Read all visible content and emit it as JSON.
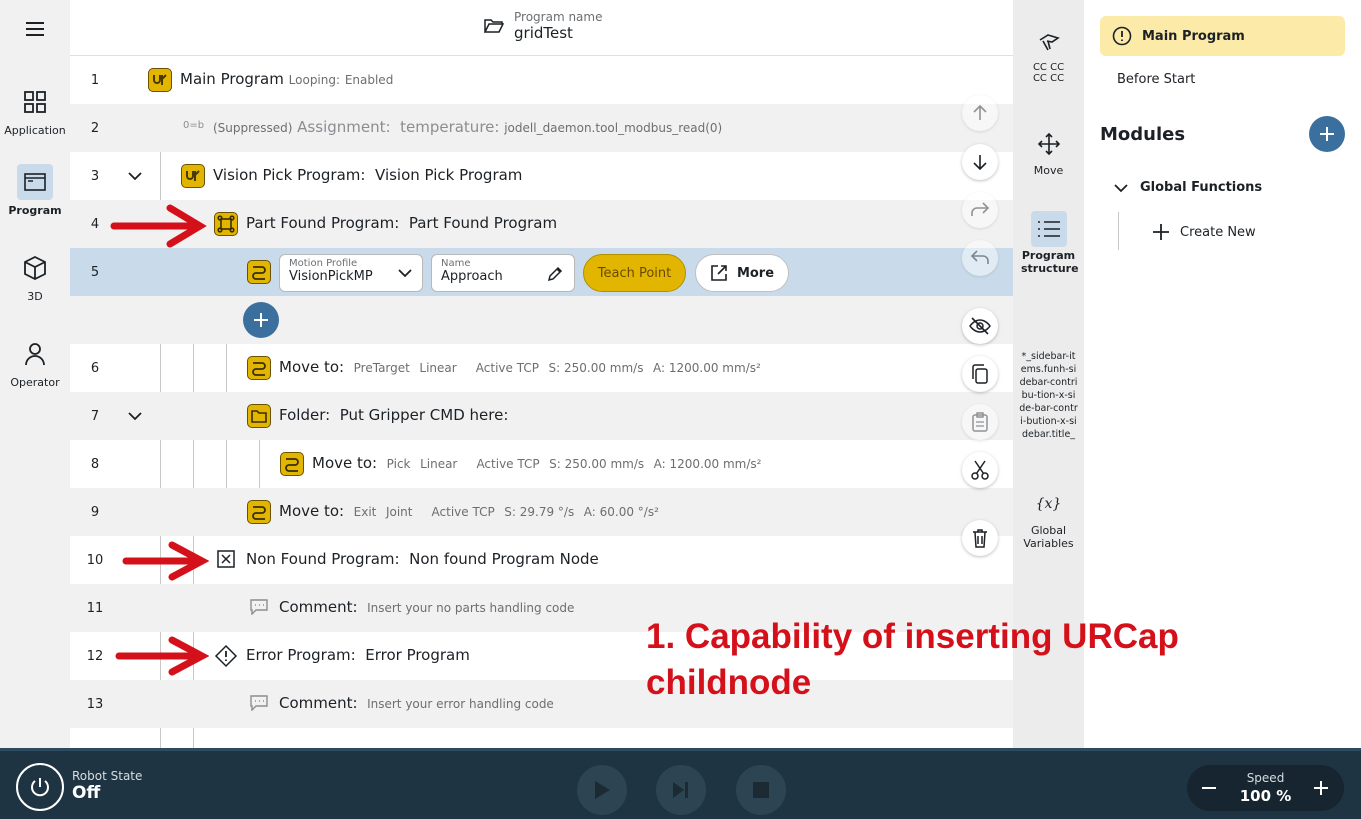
{
  "header": {
    "subtitle": "Program name",
    "title": "gridTest"
  },
  "nav": [
    {
      "label": "Application"
    },
    {
      "label": "Program"
    },
    {
      "label": "3D"
    },
    {
      "label": "Operator"
    }
  ],
  "rows": {
    "r1": {
      "num": "1",
      "title": "Main Program",
      "k": "Looping:",
      "v": "Enabled"
    },
    "r2": {
      "num": "2",
      "icon": "0=b",
      "pre": "(Suppressed)",
      "title": "Assignment:",
      "var": "temperature:",
      "expr": "jodell_daemon.tool_modbus_read(0)"
    },
    "r3": {
      "num": "3",
      "title": "Vision Pick Program:",
      "name": "Vision Pick Program"
    },
    "r4": {
      "num": "4",
      "title": "Part Found Program:",
      "name": "Part Found Program"
    },
    "r5": {
      "num": "5",
      "motion_label": "Motion Profile",
      "motion_value": "VisionPickMP",
      "name_label": "Name",
      "name_value": "Approach",
      "teach": "Teach Point",
      "more": "More"
    },
    "r6": {
      "num": "6",
      "title": "Move to:",
      "target": "PreTarget",
      "type": "Linear",
      "tcp": "Active TCP",
      "s": "S: 250.00 mm/s",
      "a": "A: 1200.00 mm/s²"
    },
    "r7": {
      "num": "7",
      "title": "Folder:",
      "name": "Put Gripper CMD here:"
    },
    "r8": {
      "num": "8",
      "title": "Move to:",
      "target": "Pick",
      "type": "Linear",
      "tcp": "Active TCP",
      "s": "S: 250.00 mm/s",
      "a": "A: 1200.00 mm/s²"
    },
    "r9": {
      "num": "9",
      "title": "Move to:",
      "target": "Exit",
      "type": "Joint",
      "tcp": "Active TCP",
      "s": "S: 29.79 °/s",
      "a": "A: 60.00 °/s²"
    },
    "r10": {
      "num": "10",
      "title": "Non Found Program:",
      "name": "Non found Program Node"
    },
    "r11": {
      "num": "11",
      "title": "Comment:",
      "text": "Insert your no parts handling code"
    },
    "r12": {
      "num": "12",
      "title": "Error Program:",
      "name": "Error Program"
    },
    "r13": {
      "num": "13",
      "title": "Comment:",
      "text": "Insert your error handling code"
    }
  },
  "rpanel": {
    "tcp": "CC CC\nCC CC",
    "move": "Move",
    "structure": "Program structure",
    "contrib": "*_sidebar-items.funh-sidebar-contribu-tion-x-side-bar-contri-bution-x-sidebar.title_",
    "globals": "Global Variables"
  },
  "side": {
    "main_program": "Main Program",
    "before_start": "Before Start",
    "modules": "Modules",
    "global_functions": "Global Functions",
    "create_new": "Create New"
  },
  "bottom": {
    "robot_state_label": "Robot State",
    "robot_state": "Off",
    "speed_label": "Speed",
    "speed_value": "100 %"
  },
  "annotation": "1. Capability of inserting URCap childnode",
  "colors": {
    "accent": "#e2b600",
    "selected_row": "#c9dbea",
    "fab_blue": "#3a6f9e",
    "arrow_red": "#d4101a",
    "bottom_bar": "#1f3442"
  }
}
